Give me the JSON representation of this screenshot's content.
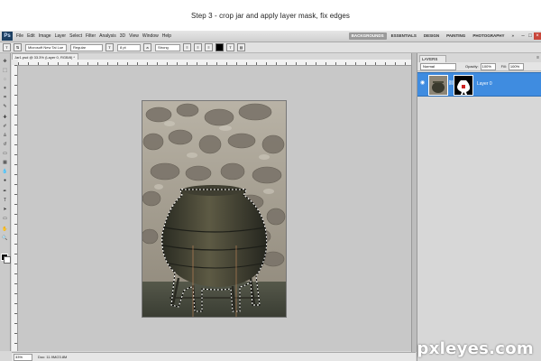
{
  "caption": "Step 3 - crop jar and apply layer mask, fix edges",
  "app": {
    "logo": "Ps",
    "menus": [
      "File",
      "Edit",
      "Image",
      "Layer",
      "Select",
      "Filter",
      "Analysis",
      "3D",
      "View",
      "Window",
      "Help"
    ],
    "workspaces": [
      "ESSENTIALS",
      "DESIGN",
      "PAINTING",
      "PHOTOGRAPHY"
    ],
    "active_workspace": "BACKGROUNDS",
    "more_workspaces": "»"
  },
  "options": {
    "font_family": "Microsoft New Tai Lue",
    "font_style": "Regular",
    "font_size": "8 pt",
    "anti_alias": "Strong"
  },
  "document": {
    "tab_label": "Jar1.psd @ 33.3% (Layer 0, RGB/8) *",
    "zoom": "33%",
    "doc_info": "Doc: 11.9M/23.8M"
  },
  "layers_panel": {
    "tab_label": "LAYERS",
    "blend_mode": "Normal",
    "opacity_label": "Opacity:",
    "opacity_value": "100%",
    "fill_label": "Fill:",
    "fill_value": "100%",
    "layers": [
      {
        "name": "Layer 0",
        "selected": true
      }
    ]
  },
  "watermark": "pxleyes.com",
  "colors": {
    "selected_layer": "#3f8ce0",
    "active_workspace_bg": "#9a9a9a",
    "workspace_bg": "#c8c8c8"
  },
  "icons": [
    "move-icon",
    "marquee-icon",
    "lasso-icon",
    "magic-wand-icon",
    "crop-icon",
    "eyedropper-icon",
    "brush-icon",
    "eraser-icon",
    "gradient-icon",
    "text-icon",
    "pen-icon",
    "zoom-icon",
    "eye-icon",
    "chain-icon"
  ]
}
